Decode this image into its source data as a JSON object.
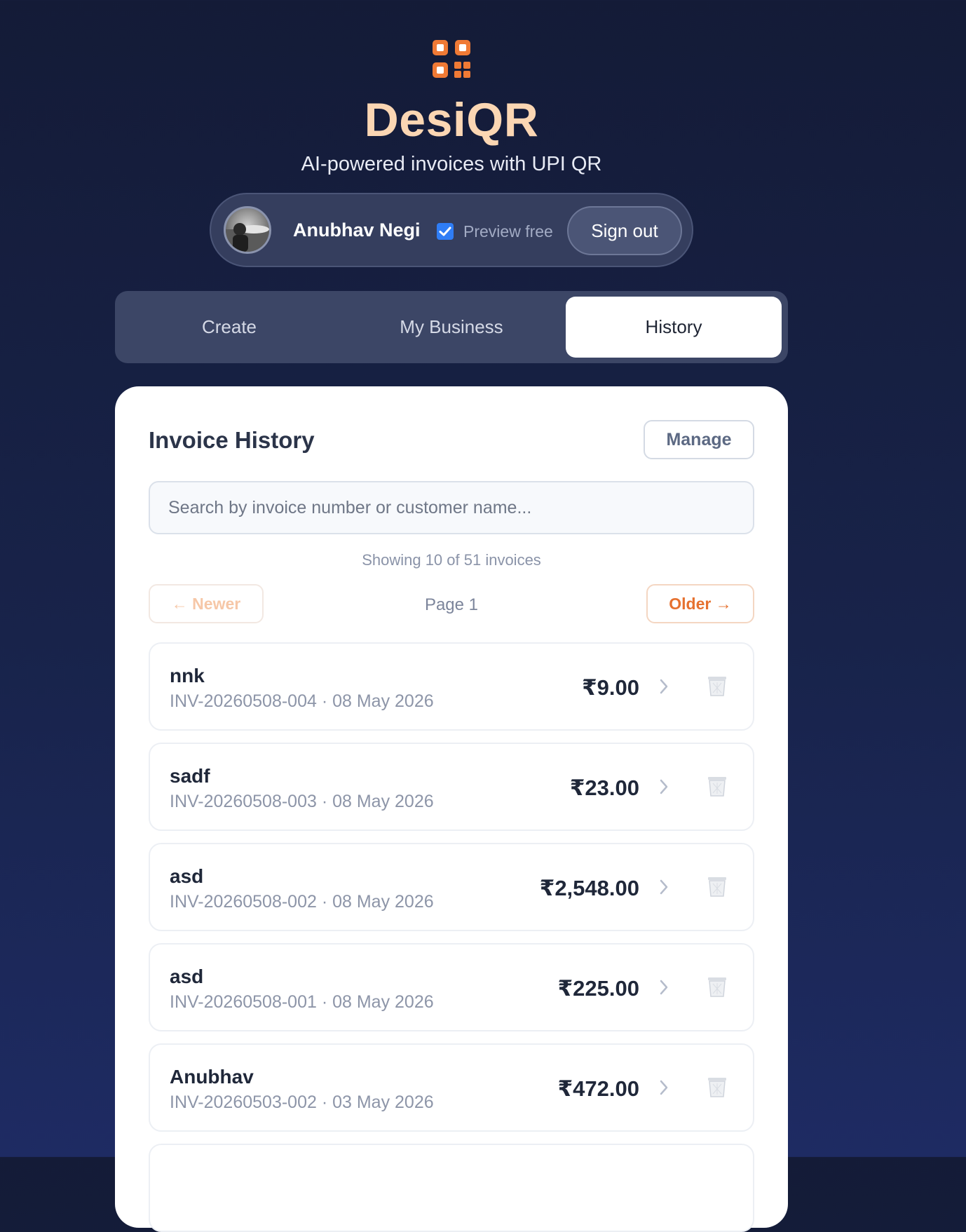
{
  "brand": {
    "title": "DesiQR",
    "tagline": "AI-powered invoices with UPI QR",
    "accent": "#f07a35",
    "title_color": "#fbd6b3"
  },
  "user": {
    "name": "Anubhav Negi",
    "preview_label": "Preview free",
    "preview_checked": true,
    "signout_label": "Sign out"
  },
  "tabs": [
    {
      "label": "Create",
      "active": false
    },
    {
      "label": "My Business",
      "active": false
    },
    {
      "label": "History",
      "active": true
    }
  ],
  "history": {
    "title": "Invoice History",
    "manage_label": "Manage",
    "search_placeholder": "Search by invoice number or customer name...",
    "showing_text": "Showing 10 of 51 invoices",
    "newer_label": "← Newer",
    "page_label": "Page 1",
    "older_label": "Older →",
    "invoices": [
      {
        "customer": "nnk",
        "meta": "INV-20260508-004 · 08 May 2026",
        "amount": "₹9.00"
      },
      {
        "customer": "sadf",
        "meta": "INV-20260508-003 · 08 May 2026",
        "amount": "₹23.00"
      },
      {
        "customer": "asd",
        "meta": "INV-20260508-002 · 08 May 2026",
        "amount": "₹2,548.00"
      },
      {
        "customer": "asd",
        "meta": "INV-20260508-001 · 08 May 2026",
        "amount": "₹225.00"
      },
      {
        "customer": "Anubhav",
        "meta": "INV-20260503-002 · 03 May 2026",
        "amount": "₹472.00"
      }
    ]
  }
}
